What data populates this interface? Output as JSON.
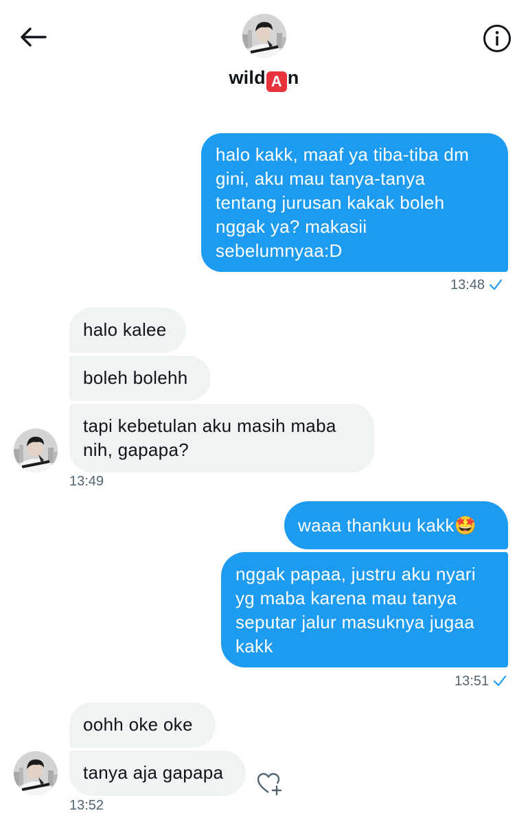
{
  "header": {
    "name_prefix": "wild",
    "name_badge": "A",
    "name_suffix": "n",
    "badge_color": "#e8323c"
  },
  "colors": {
    "sent_bubble": "#1d9bf0",
    "received_bubble": "#eff3f4",
    "timestamp": "#536471"
  },
  "icons": {
    "back": "arrow-left-icon",
    "info": "info-circle-icon",
    "read": "checkmark-icon",
    "react": "heart-plus-icon"
  },
  "messages": {
    "m1": {
      "lines": [
        "halo kakk, maaf ya tiba-tiba dm",
        "gini, aku mau tanya-tanya",
        "tentang jurusan kakak boleh",
        "nggak ya? makasii",
        "sebelumnyaa:D"
      ],
      "time": "13:48"
    },
    "m2": "halo kalee",
    "m3": "boleh bolehh",
    "m4": {
      "lines": [
        "tapi kebetulan aku masih maba",
        "nih, gapapa?"
      ],
      "time": "13:49"
    },
    "m5": {
      "text": "waaa thankuu kakk",
      "emoji": "🤩"
    },
    "m6": {
      "lines": [
        "nggak papaa, justru aku nyari",
        "yg maba karena mau tanya",
        "seputar jalur masuknya jugaa",
        "kakk"
      ],
      "time": "13:51"
    },
    "m7": "oohh oke oke",
    "m8": {
      "text": "tanya aja gapapa",
      "time": "13:52"
    }
  }
}
